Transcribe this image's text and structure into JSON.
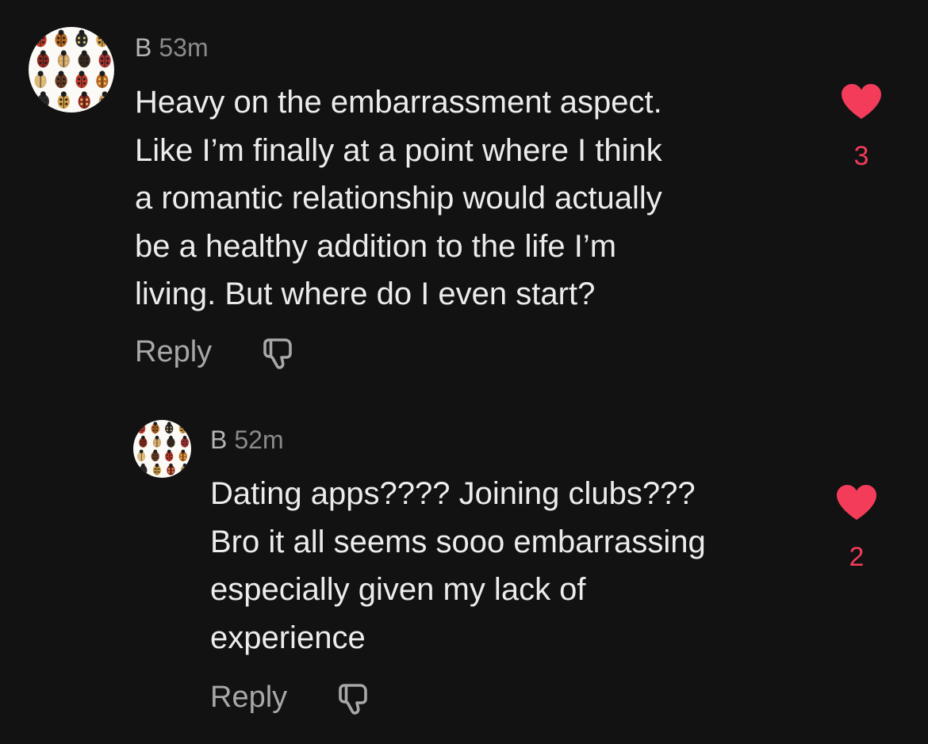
{
  "colors": {
    "background": "#121212",
    "text": "#ececec",
    "author": "#b4b4b4",
    "timestamp": "#8a8a8a",
    "action": "#a8a8a8",
    "like": "#f23c5a"
  },
  "comments": [
    {
      "author": "B",
      "time": "53m",
      "text": "Heavy on the embarrassment aspect.\nLike I’m finally at a point where I think\na romantic relationship would actually\nbe a healthy addition to the life I’m\nliving. But where do I even start?",
      "likes": "3",
      "reply_label": "Reply",
      "avatar_icon": "ladybug-collection-avatar",
      "like_icon": "heart-icon",
      "dislike_icon": "thumbs-down-icon"
    },
    {
      "author": "B",
      "time": "52m",
      "text": "Dating apps???? Joining clubs???\nBro it all seems sooo embarrassing\nespecially given my lack of\nexperience",
      "likes": "2",
      "reply_label": "Reply",
      "avatar_icon": "ladybug-collection-avatar",
      "like_icon": "heart-icon",
      "dislike_icon": "thumbs-down-icon"
    }
  ]
}
